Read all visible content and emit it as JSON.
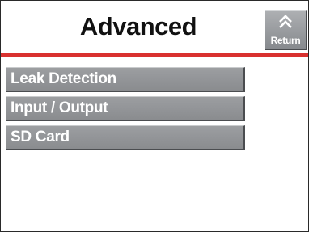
{
  "header": {
    "title": "Advanced",
    "return_label": "Return",
    "return_icon": "chevron-up-icon"
  },
  "colors": {
    "accent_bar": "#d9312f",
    "button_face": "#8f9194",
    "button_text": "#ffffff",
    "title_text": "#111111",
    "background": "#ffffff"
  },
  "menu": {
    "items": [
      {
        "label": "Leak Detection"
      },
      {
        "label": "Input / Output"
      },
      {
        "label": "SD Card"
      }
    ]
  }
}
